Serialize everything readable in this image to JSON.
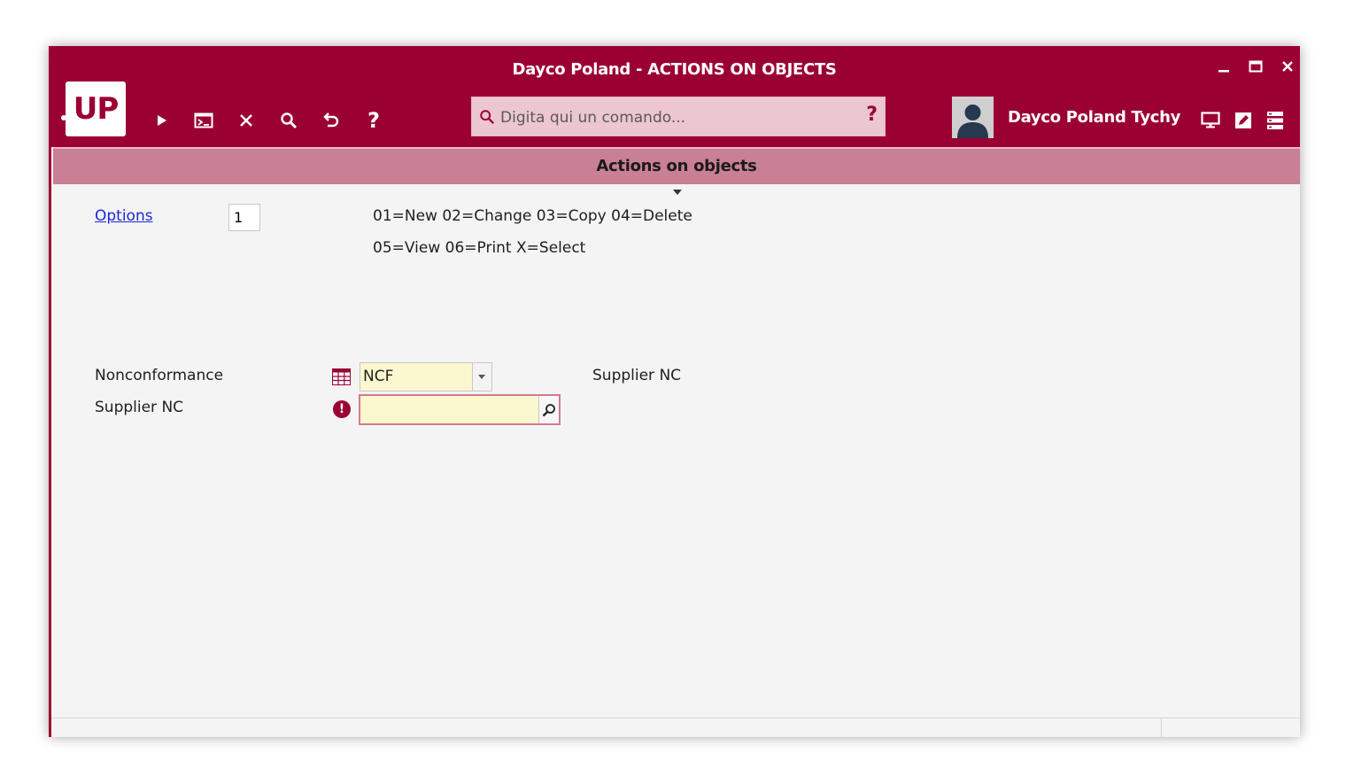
{
  "window": {
    "title": "Dayco Poland - ACTIONS ON OBJECTS",
    "controls": {
      "minimize": "_",
      "maximize": "☐",
      "close": "✕"
    }
  },
  "logo": {
    "text": "UP"
  },
  "toolbar": {
    "icons": [
      "play-icon",
      "terminal-icon",
      "close-icon",
      "search-icon",
      "undo-icon",
      "help-icon"
    ],
    "help_label": "?"
  },
  "command_box": {
    "placeholder": "Digita qui un comando...",
    "help_label": "?"
  },
  "user": {
    "name": "Dayco Poland Tychy"
  },
  "header_right_icons": [
    "monitor-icon",
    "edit-icon",
    "menu-list-icon"
  ],
  "subheader": {
    "title": "Actions on objects"
  },
  "form": {
    "options_label": "Options",
    "options_value": "1",
    "options_hint_line1": "01=New 02=Change 03=Copy 04=Delete",
    "options_hint_line2": "05=View 06=Print X=Select",
    "nonconformance_label": "Nonconformance",
    "nonconformance_value": "NCF",
    "nonconformance_description": "Supplier NC",
    "supplier_nc_label": "Supplier NC",
    "supplier_nc_value": "",
    "error_symbol": "!"
  },
  "colors": {
    "brand": "#9b0033",
    "subheader": "#c97f94",
    "input_highlight": "#fbf7cf",
    "link": "#1a29d6"
  }
}
